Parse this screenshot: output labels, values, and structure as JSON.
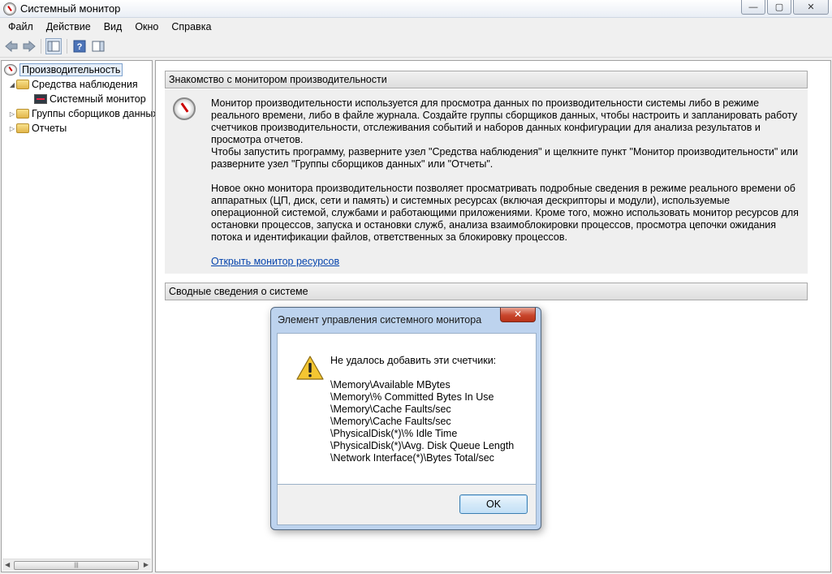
{
  "window": {
    "title": "Системный монитор",
    "caption": {
      "minimize": "—",
      "maximize": "▢",
      "close": "✕"
    }
  },
  "menu": [
    "Файл",
    "Действие",
    "Вид",
    "Окно",
    "Справка"
  ],
  "toolbar": {
    "back_icon": "arrow-left-icon",
    "forward_icon": "arrow-right-icon",
    "help_label": "?"
  },
  "tree": {
    "root": "Производительность",
    "monitoring_tools": "Средства наблюдения",
    "system_monitor": "Системный монитор",
    "data_collector_sets": "Группы сборщиков данных",
    "reports": "Отчеты"
  },
  "main": {
    "intro_header": "Знакомство с монитором производительности",
    "para1": "Монитор производительности используется для просмотра данных по производительности системы либо в режиме реального времени, либо в файле журнала. Создайте группы сборщиков данных, чтобы настроить и запланировать работу счетчиков производительности, отслеживания событий и наборов данных конфигурации для анализа результатов и просмотра отчетов.",
    "para2": "Чтобы запустить программу, разверните узел \"Средства наблюдения\" и щелкните пункт \"Монитор производительности\" или разверните узел \"Группы сборщиков данных\" или \"Отчеты\".",
    "para3": "Новое окно монитора производительности позволяет просматривать подробные сведения в режиме реального времени об аппаратных (ЦП, диск, сети и память) и системных ресурсах (включая дескрипторы и модули), используемые операционной системой, службами и работающими приложениями. Кроме того, можно использовать монитор ресурсов для остановки процессов, запуска и остановки служб, анализа взаимоблокировки процессов, просмотра цепочки ожидания потока и идентификации файлов, ответственных за блокировку процессов.",
    "resource_monitor_link": "Открыть монитор ресурсов",
    "summary_header": "Сводные сведения о системе"
  },
  "dialog": {
    "title": "Элемент управления системного монитора",
    "close": "✕",
    "message": "Не удалось добавить эти счетчики:",
    "counters": [
      "\\Memory\\Available MBytes",
      "\\Memory\\% Committed Bytes In Use",
      "\\Memory\\Cache Faults/sec",
      "\\Memory\\Cache Faults/sec",
      "\\PhysicalDisk(*)\\% Idle Time",
      "\\PhysicalDisk(*)\\Avg. Disk Queue Length",
      "\\Network Interface(*)\\Bytes Total/sec"
    ],
    "ok_label": "OK"
  }
}
